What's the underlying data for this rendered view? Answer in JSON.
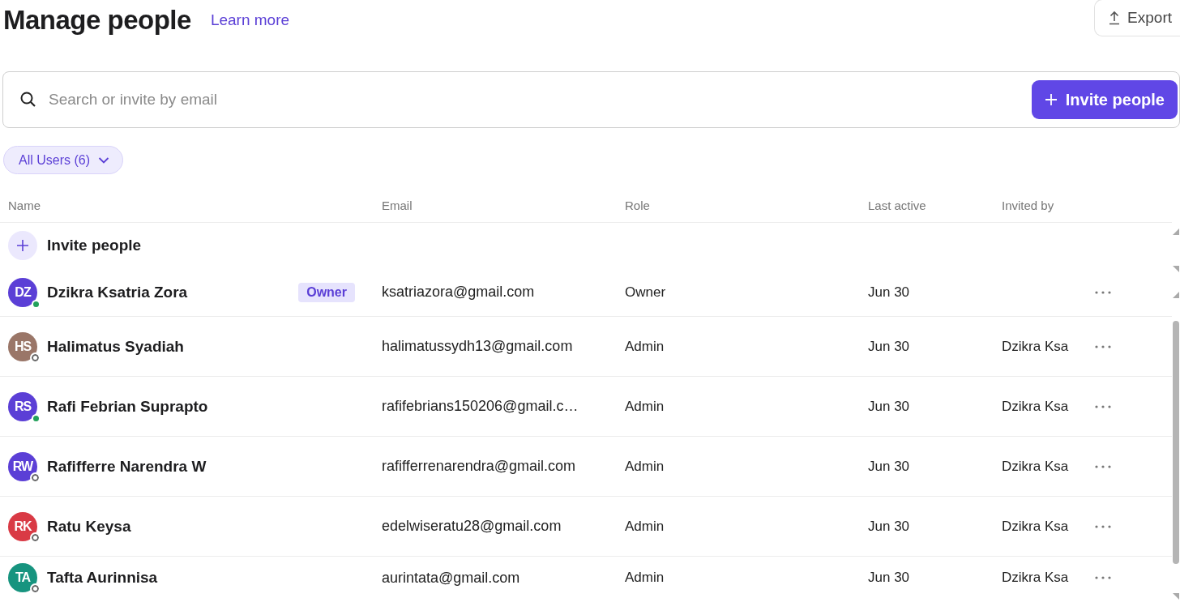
{
  "header": {
    "title": "Manage people",
    "learn_more": "Learn more",
    "export_button": "Export"
  },
  "search": {
    "placeholder": "Search or invite by email",
    "invite_button": "Invite people"
  },
  "filter": {
    "label": "All Users (6)"
  },
  "table": {
    "columns": [
      "Name",
      "Email",
      "Role",
      "Last active",
      "Invited by"
    ],
    "invite_row": "Invite people",
    "rows": [
      {
        "initials": "DZ",
        "color": "#5b3fd6",
        "online": true,
        "name": "Dzikra Ksatria Zora",
        "badge": "Owner",
        "email": "ksatriazora@gmail.com",
        "role": "Owner",
        "last_active": "Jun 30"
      },
      {
        "initials": "HS",
        "color": "#9a7668",
        "online": false,
        "name": "Halimatus Syadiah",
        "email": "halimatussydh13@gmail.com",
        "role": "Admin",
        "last_active": "Jun 30",
        "invited_by": "Dzikra Ksa"
      },
      {
        "initials": "RS",
        "color": "#5b3fd6",
        "online": true,
        "name": "Rafi Febrian Suprapto",
        "email": "rafifebrians150206@gmail.c…",
        "role": "Admin",
        "last_active": "Jun 30",
        "invited_by": "Dzikra Ksa"
      },
      {
        "initials": "RW",
        "color": "#5b3fd6",
        "online": false,
        "name": "Rafifferre Narendra W",
        "email": "rafifferrenarendra@gmail.com",
        "role": "Admin",
        "last_active": "Jun 30",
        "invited_by": "Dzikra Ksa"
      },
      {
        "initials": "RK",
        "color": "#d93a45",
        "online": false,
        "name": "Ratu Keysa",
        "email": "edelwiseratu28@gmail.com",
        "role": "Admin",
        "last_active": "Jun 30",
        "invited_by": "Dzikra Ksa"
      },
      {
        "initials": "TA",
        "color": "#17947f",
        "online": false,
        "name": "Tafta Aurinnisa",
        "email": "aurintata@gmail.com",
        "role": "Admin",
        "last_active": "Jun 30",
        "invited_by": "Dzikra Ksa"
      }
    ]
  }
}
